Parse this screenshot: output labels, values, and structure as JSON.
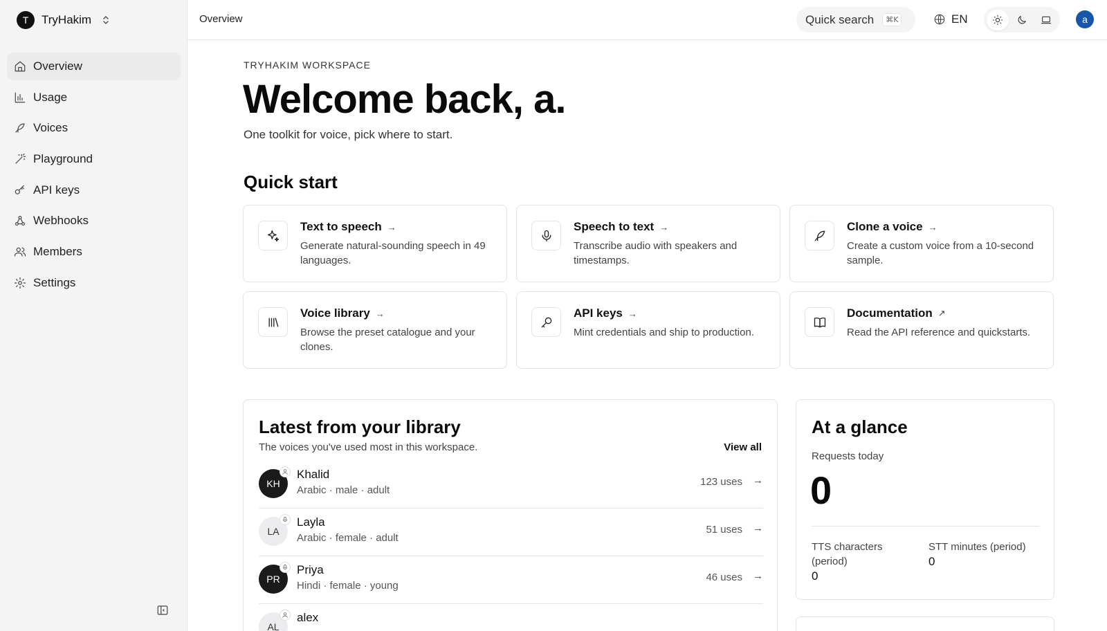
{
  "workspace": {
    "initial": "T",
    "name": "TryHakim"
  },
  "nav": [
    {
      "id": "overview",
      "label": "Overview",
      "icon": "home-icon",
      "active": true
    },
    {
      "id": "usage",
      "label": "Usage",
      "icon": "bar-chart-icon"
    },
    {
      "id": "voices",
      "label": "Voices",
      "icon": "feather-icon"
    },
    {
      "id": "playground",
      "label": "Playground",
      "icon": "magic-wand-icon"
    },
    {
      "id": "api-keys",
      "label": "API keys",
      "icon": "key-icon"
    },
    {
      "id": "webhooks",
      "label": "Webhooks",
      "icon": "webhook-icon"
    },
    {
      "id": "members",
      "label": "Members",
      "icon": "users-icon"
    },
    {
      "id": "settings",
      "label": "Settings",
      "icon": "gear-icon"
    }
  ],
  "topbar": {
    "breadcrumb": "Overview",
    "search_label": "Quick search",
    "search_shortcut": "⌘K",
    "language": "EN",
    "theme_selected": "light",
    "user_initial": "a"
  },
  "hero": {
    "eyebrow": "TRYHAKIM WORKSPACE",
    "title": "Welcome back, a.",
    "subtitle": "One toolkit for voice, pick where to start."
  },
  "quick_start": {
    "title": "Quick start",
    "cards": [
      {
        "title": "Text to speech",
        "arrow": "→",
        "desc": "Generate natural-sounding speech in 49 languages.",
        "icon": "sparkles-icon"
      },
      {
        "title": "Speech to text",
        "arrow": "→",
        "desc": "Transcribe audio with speakers and timestamps.",
        "icon": "microphone-icon"
      },
      {
        "title": "Clone a voice",
        "arrow": "→",
        "desc": "Create a custom voice from a 10-second sample.",
        "icon": "feather-icon"
      },
      {
        "title": "Voice library",
        "arrow": "→",
        "desc": "Browse the preset catalogue and your clones.",
        "icon": "library-icon"
      },
      {
        "title": "API keys",
        "arrow": "→",
        "desc": "Mint credentials and ship to production.",
        "icon": "key-icon"
      },
      {
        "title": "Documentation",
        "arrow": "↗",
        "desc": "Read the API reference and quickstarts.",
        "icon": "book-icon"
      }
    ]
  },
  "library": {
    "title": "Latest from your library",
    "subtitle": "The voices you've used most in this workspace.",
    "view_all": "View all",
    "voices": [
      {
        "initials": "KH",
        "name": "Khalid",
        "meta": "Arabic · male · adult",
        "uses": "123 uses",
        "style": "dark",
        "badge": "user-icon"
      },
      {
        "initials": "LA",
        "name": "Layla",
        "meta": "Arabic · female · adult",
        "uses": "51 uses",
        "style": "light",
        "badge": "microphone-icon"
      },
      {
        "initials": "PR",
        "name": "Priya",
        "meta": "Hindi · female · young",
        "uses": "46 uses",
        "style": "dark",
        "badge": "microphone-icon"
      },
      {
        "initials": "AL",
        "name": "alex",
        "meta": "",
        "uses": "",
        "style": "light",
        "badge": "user-icon"
      }
    ]
  },
  "glance": {
    "title": "At a glance",
    "requests_label": "Requests today",
    "requests_value": "0",
    "tts_label": "TTS characters (period)",
    "tts_value": "0",
    "stt_label": "STT minutes (period)",
    "stt_value": "0"
  }
}
